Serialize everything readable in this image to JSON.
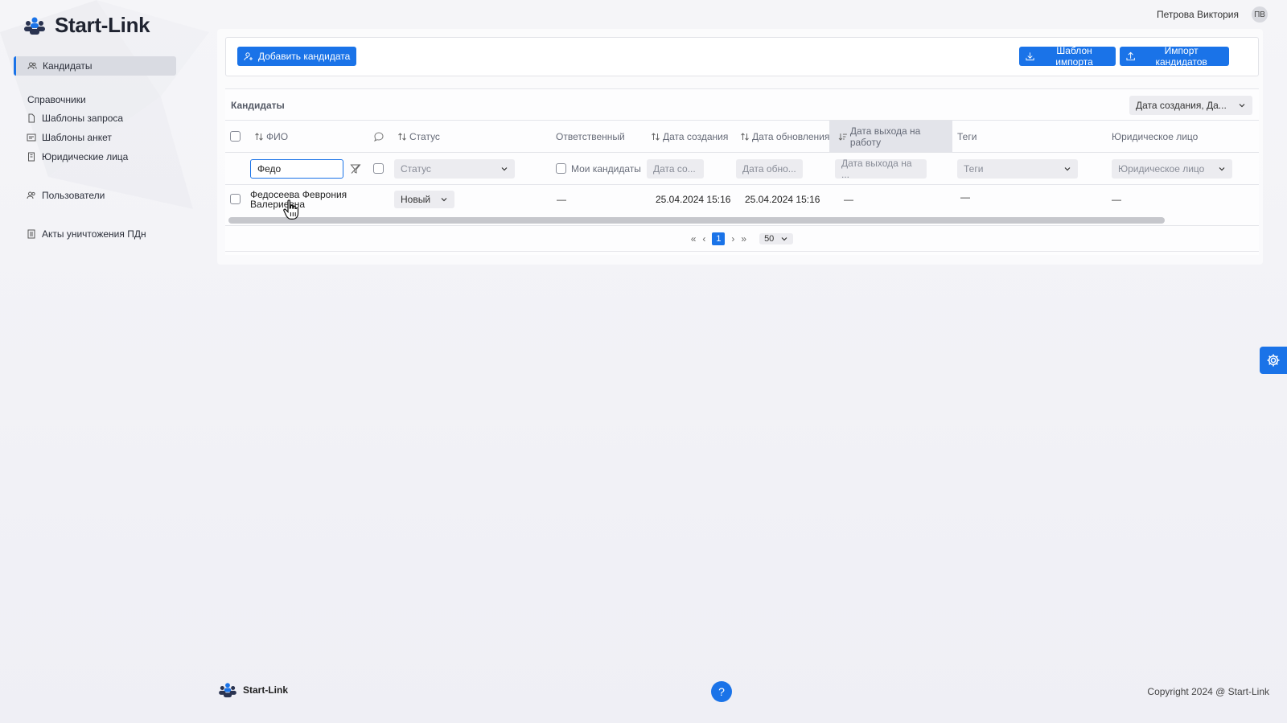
{
  "app": {
    "name": "Start-Link"
  },
  "user": {
    "name": "Петрова Виктория",
    "initials": "ПВ"
  },
  "sidebar": {
    "candidates": "Кандидаты",
    "section_reference": "Справочники",
    "request_templates": "Шаблоны запроса",
    "survey_templates": "Шаблоны анкет",
    "legal_entities": "Юридические лица",
    "users": "Пользователи",
    "pd_destruction_acts": "Акты уничтожения ПДн"
  },
  "toolbar": {
    "add_candidate": "Добавить кандидата",
    "import_template": "Шаблон импорта",
    "import_candidates": "Импорт кандидатов"
  },
  "table": {
    "title": "Кандидаты",
    "sort_select": "Дата создания, Да...",
    "headers": {
      "fio": "ФИО",
      "status": "Статус",
      "responsible": "Ответственный",
      "created": "Дата создания",
      "updated": "Дата обновления",
      "start_date": "Дата выхода на работу",
      "tags": "Теги",
      "legal_entity": "Юридическое лицо"
    },
    "filters": {
      "fio_value": "Федо",
      "status_placeholder": "Статус",
      "my_candidates": "Мои кандидаты",
      "created_placeholder": "Дата со...",
      "updated_placeholder": "Дата обно...",
      "start_placeholder": "Дата выхода на ...",
      "tags_placeholder": "Теги",
      "legal_placeholder": "Юридическое лицо"
    },
    "rows": [
      {
        "fio_line1": "Федосеева Феврония",
        "fio_line2": "Валериевна",
        "status": "Новый",
        "responsible": "—",
        "created": "25.04.2024 15:16",
        "updated": "25.04.2024 15:16",
        "start_date": "—",
        "tags": "—",
        "legal_entity": "—"
      }
    ]
  },
  "pagination": {
    "current_page": "1",
    "page_size": "50",
    "first": "«",
    "prev": "‹",
    "next": "›",
    "last": "»"
  },
  "footer": {
    "logo": "Start-Link",
    "help": "?",
    "copyright": "Copyright 2024 @ Start-Link"
  },
  "colors": {
    "accent": "#1a73e8"
  }
}
